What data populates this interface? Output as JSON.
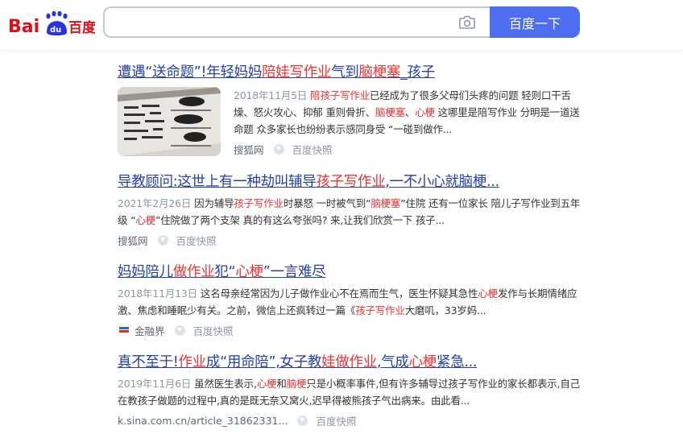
{
  "header": {
    "logo_text_bai": "Bai",
    "logo_text_du": "du",
    "logo_text_cn": "百度",
    "search_value": "",
    "search_button": "百度一下"
  },
  "colors": {
    "brand_blue": "#4e6ef2",
    "logo_red": "#de0f17",
    "logo_blue": "#2932e1",
    "title_link": "#2440b3",
    "highlight_red": "#f73131"
  },
  "results": [
    {
      "title": [
        {
          "t": "遭遇“送命题”!年轻妈妈"
        },
        {
          "t": "陪娃写作业",
          "em": true
        },
        {
          "t": "气到"
        },
        {
          "t": "脑梗塞",
          "em": true
        },
        {
          "t": "_孩子"
        }
      ],
      "date": "2018年11月5日",
      "abstract": [
        {
          "t": "陪孩子写作业",
          "em": true
        },
        {
          "t": "已经成为了很多父母们头疼的问题 轻则口干舌燥、怒火攻心、抑郁 重则骨折、"
        },
        {
          "t": "脑梗塞",
          "em": true
        },
        {
          "t": "、"
        },
        {
          "t": "心梗",
          "em": true
        },
        {
          "t": " 这哪里是陪写作业 分明是一道送命题 众多家长也纷纷表示感同身受 “一碰到做作..."
        }
      ],
      "source": "搜狐网",
      "cache": "百度快照",
      "has_thumb": true
    },
    {
      "title": [
        {
          "t": "导教顾问:这世上有一种劫叫辅导"
        },
        {
          "t": "孩子写作业",
          "em": true
        },
        {
          "t": ",一不小心就脑梗..."
        }
      ],
      "date": "2021年2月26日",
      "abstract": [
        {
          "t": "因为辅导"
        },
        {
          "t": "孩子写作业",
          "em": true
        },
        {
          "t": "时暴怒 一时被气到“"
        },
        {
          "t": "脑梗塞",
          "em": true
        },
        {
          "t": "”住院 还有一位家长 陪儿子写作业到五年级 “"
        },
        {
          "t": "心梗",
          "em": true
        },
        {
          "t": "”住院做了两个支架 真的有这么夸张吗? 来,让我们欣赏一下 孩子..."
        }
      ],
      "source": "搜狐网",
      "cache": "百度快照",
      "has_thumb": false
    },
    {
      "title": [
        {
          "t": "妈妈陪儿"
        },
        {
          "t": "做作业",
          "em": true
        },
        {
          "t": "犯“"
        },
        {
          "t": "心梗",
          "em": true
        },
        {
          "t": "”一言难尽"
        }
      ],
      "date": "2018年11月13日",
      "abstract": [
        {
          "t": "这名母亲经常因为儿子做作业心不在焉而生气，医生怀疑其急性"
        },
        {
          "t": "心梗",
          "em": true
        },
        {
          "t": "发作与长期情绪应激、焦虑和睡眠少有关。之前，微信上还疯转过一篇《"
        },
        {
          "t": "孩子写作业",
          "em": true
        },
        {
          "t": "大磨叽，33岁妈..."
        }
      ],
      "source": "金融界",
      "cache": "百度快照",
      "has_thumb": false,
      "site_icon": true
    },
    {
      "title": [
        {
          "t": "真不至于!"
        },
        {
          "t": "作业",
          "em": true
        },
        {
          "t": "成“用命陪”,女子教"
        },
        {
          "t": "娃做作业",
          "em": true
        },
        {
          "t": ",气成"
        },
        {
          "t": "心梗",
          "em": true
        },
        {
          "t": "紧急..."
        }
      ],
      "date": "2019年11月6日",
      "abstract": [
        {
          "t": "虽然医生表示,"
        },
        {
          "t": "心梗",
          "em": true
        },
        {
          "t": "和"
        },
        {
          "t": "脑梗",
          "em": true
        },
        {
          "t": "只是小概率事件,但有许多辅导过孩子写作业的家长都表示,自己在教孩子做题的过程中,真的是既无奈又窝火,迟早得被熊孩子气出病来。由此看..."
        }
      ],
      "source": "k.sina.com.cn/article_31862331...",
      "cache": "百度快照",
      "has_thumb": false
    }
  ]
}
